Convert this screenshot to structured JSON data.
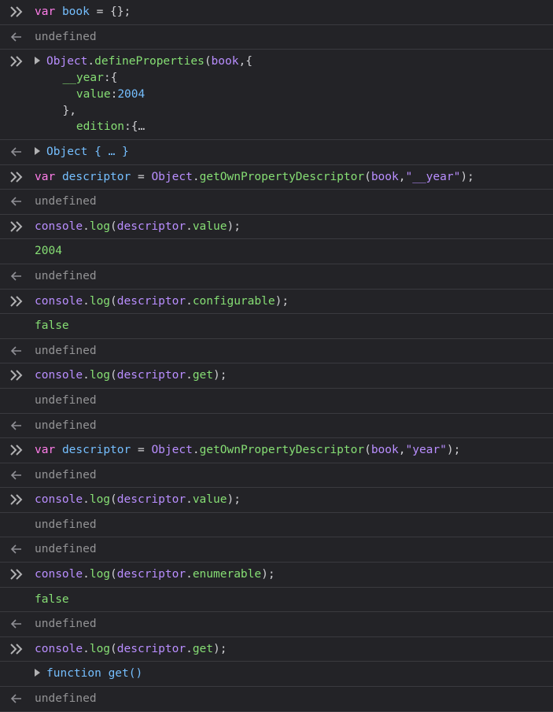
{
  "colors": {
    "background": "#232327",
    "separator": "#3a3a3f",
    "keyword": "#ff7de9",
    "identifier": "#75bfff",
    "method": "#86de74",
    "string": "#b98eff",
    "undefined": "#939395"
  },
  "icons": {
    "input": "chevron-double-right-icon",
    "output": "arrow-left-icon",
    "expand": "disclosure-triangle-icon"
  },
  "entries": [
    {
      "kind": "input",
      "tokens": [
        [
          "kw",
          "var"
        ],
        [
          "pun",
          " "
        ],
        [
          "var",
          "book"
        ],
        [
          "pun",
          " = {};"
        ]
      ]
    },
    {
      "kind": "result",
      "tokens": [
        [
          "undef",
          "undefined"
        ]
      ]
    },
    {
      "kind": "input",
      "expandable": true,
      "tokens": [
        [
          "obj",
          "Object"
        ],
        [
          "pun",
          "."
        ],
        [
          "fn",
          "defineProperties"
        ],
        [
          "pun",
          "("
        ],
        [
          "obj",
          "book"
        ],
        [
          "pun",
          ",{"
        ]
      ],
      "extra_lines": [
        [
          [
            "pun",
            "  "
          ],
          [
            "fn",
            "__year"
          ],
          [
            "pun",
            ":{"
          ]
        ],
        [
          [
            "pun",
            "    "
          ],
          [
            "fn",
            "value"
          ],
          [
            "pun",
            ":"
          ],
          [
            "blue",
            "2004"
          ]
        ],
        [
          [
            "pun",
            "  },"
          ]
        ],
        [
          [
            "pun",
            "    "
          ],
          [
            "fn",
            "edition"
          ],
          [
            "pun",
            ":{…"
          ]
        ]
      ]
    },
    {
      "kind": "result",
      "expandable": true,
      "tokens": [
        [
          "blue",
          "Object { … }"
        ]
      ]
    },
    {
      "kind": "input",
      "tokens": [
        [
          "kw",
          "var"
        ],
        [
          "pun",
          " "
        ],
        [
          "var",
          "descriptor"
        ],
        [
          "pun",
          " = "
        ],
        [
          "obj",
          "Object"
        ],
        [
          "pun",
          "."
        ],
        [
          "fn",
          "getOwnPropertyDescriptor"
        ],
        [
          "pun",
          "("
        ],
        [
          "obj",
          "book"
        ],
        [
          "pun",
          ","
        ],
        [
          "str",
          "\"__year\""
        ],
        [
          "pun",
          ");"
        ]
      ]
    },
    {
      "kind": "result",
      "tokens": [
        [
          "undef",
          "undefined"
        ]
      ]
    },
    {
      "kind": "input",
      "tokens": [
        [
          "prop",
          "console"
        ],
        [
          "pun",
          "."
        ],
        [
          "fn",
          "log"
        ],
        [
          "pun",
          "("
        ],
        [
          "prop",
          "descriptor"
        ],
        [
          "pun",
          "."
        ],
        [
          "fn",
          "value"
        ],
        [
          "pun",
          ");"
        ]
      ]
    },
    {
      "kind": "log",
      "tokens": [
        [
          "num",
          "2004"
        ]
      ]
    },
    {
      "kind": "result",
      "tokens": [
        [
          "undef",
          "undefined"
        ]
      ]
    },
    {
      "kind": "input",
      "tokens": [
        [
          "prop",
          "console"
        ],
        [
          "pun",
          "."
        ],
        [
          "fn",
          "log"
        ],
        [
          "pun",
          "("
        ],
        [
          "prop",
          "descriptor"
        ],
        [
          "pun",
          "."
        ],
        [
          "fn",
          "configurable"
        ],
        [
          "pun",
          ");"
        ]
      ]
    },
    {
      "kind": "log",
      "tokens": [
        [
          "bool",
          "false"
        ]
      ]
    },
    {
      "kind": "result",
      "tokens": [
        [
          "undef",
          "undefined"
        ]
      ]
    },
    {
      "kind": "input",
      "tokens": [
        [
          "prop",
          "console"
        ],
        [
          "pun",
          "."
        ],
        [
          "fn",
          "log"
        ],
        [
          "pun",
          "("
        ],
        [
          "prop",
          "descriptor"
        ],
        [
          "pun",
          "."
        ],
        [
          "fn",
          "get"
        ],
        [
          "pun",
          ");"
        ]
      ]
    },
    {
      "kind": "log",
      "tokens": [
        [
          "undef",
          "undefined"
        ]
      ]
    },
    {
      "kind": "result",
      "tokens": [
        [
          "undef",
          "undefined"
        ]
      ]
    },
    {
      "kind": "input",
      "tokens": [
        [
          "kw",
          "var"
        ],
        [
          "pun",
          " "
        ],
        [
          "var",
          "descriptor"
        ],
        [
          "pun",
          " = "
        ],
        [
          "obj",
          "Object"
        ],
        [
          "pun",
          "."
        ],
        [
          "fn",
          "getOwnPropertyDescriptor"
        ],
        [
          "pun",
          "("
        ],
        [
          "obj",
          "book"
        ],
        [
          "pun",
          ","
        ],
        [
          "str",
          "\"year\""
        ],
        [
          "pun",
          ");"
        ]
      ]
    },
    {
      "kind": "result",
      "tokens": [
        [
          "undef",
          "undefined"
        ]
      ]
    },
    {
      "kind": "input",
      "tokens": [
        [
          "prop",
          "console"
        ],
        [
          "pun",
          "."
        ],
        [
          "fn",
          "log"
        ],
        [
          "pun",
          "("
        ],
        [
          "prop",
          "descriptor"
        ],
        [
          "pun",
          "."
        ],
        [
          "fn",
          "value"
        ],
        [
          "pun",
          ");"
        ]
      ]
    },
    {
      "kind": "log",
      "tokens": [
        [
          "undef",
          "undefined"
        ]
      ]
    },
    {
      "kind": "result",
      "tokens": [
        [
          "undef",
          "undefined"
        ]
      ]
    },
    {
      "kind": "input",
      "tokens": [
        [
          "prop",
          "console"
        ],
        [
          "pun",
          "."
        ],
        [
          "fn",
          "log"
        ],
        [
          "pun",
          "("
        ],
        [
          "prop",
          "descriptor"
        ],
        [
          "pun",
          "."
        ],
        [
          "fn",
          "enumerable"
        ],
        [
          "pun",
          ");"
        ]
      ]
    },
    {
      "kind": "log",
      "tokens": [
        [
          "bool",
          "false"
        ]
      ]
    },
    {
      "kind": "result",
      "tokens": [
        [
          "undef",
          "undefined"
        ]
      ]
    },
    {
      "kind": "input",
      "tokens": [
        [
          "prop",
          "console"
        ],
        [
          "pun",
          "."
        ],
        [
          "fn",
          "log"
        ],
        [
          "pun",
          "("
        ],
        [
          "prop",
          "descriptor"
        ],
        [
          "pun",
          "."
        ],
        [
          "fn",
          "get"
        ],
        [
          "pun",
          ");"
        ]
      ]
    },
    {
      "kind": "log",
      "expandable": true,
      "tokens": [
        [
          "blue",
          "function get()"
        ]
      ]
    },
    {
      "kind": "result",
      "tokens": [
        [
          "undef",
          "undefined"
        ]
      ]
    }
  ]
}
